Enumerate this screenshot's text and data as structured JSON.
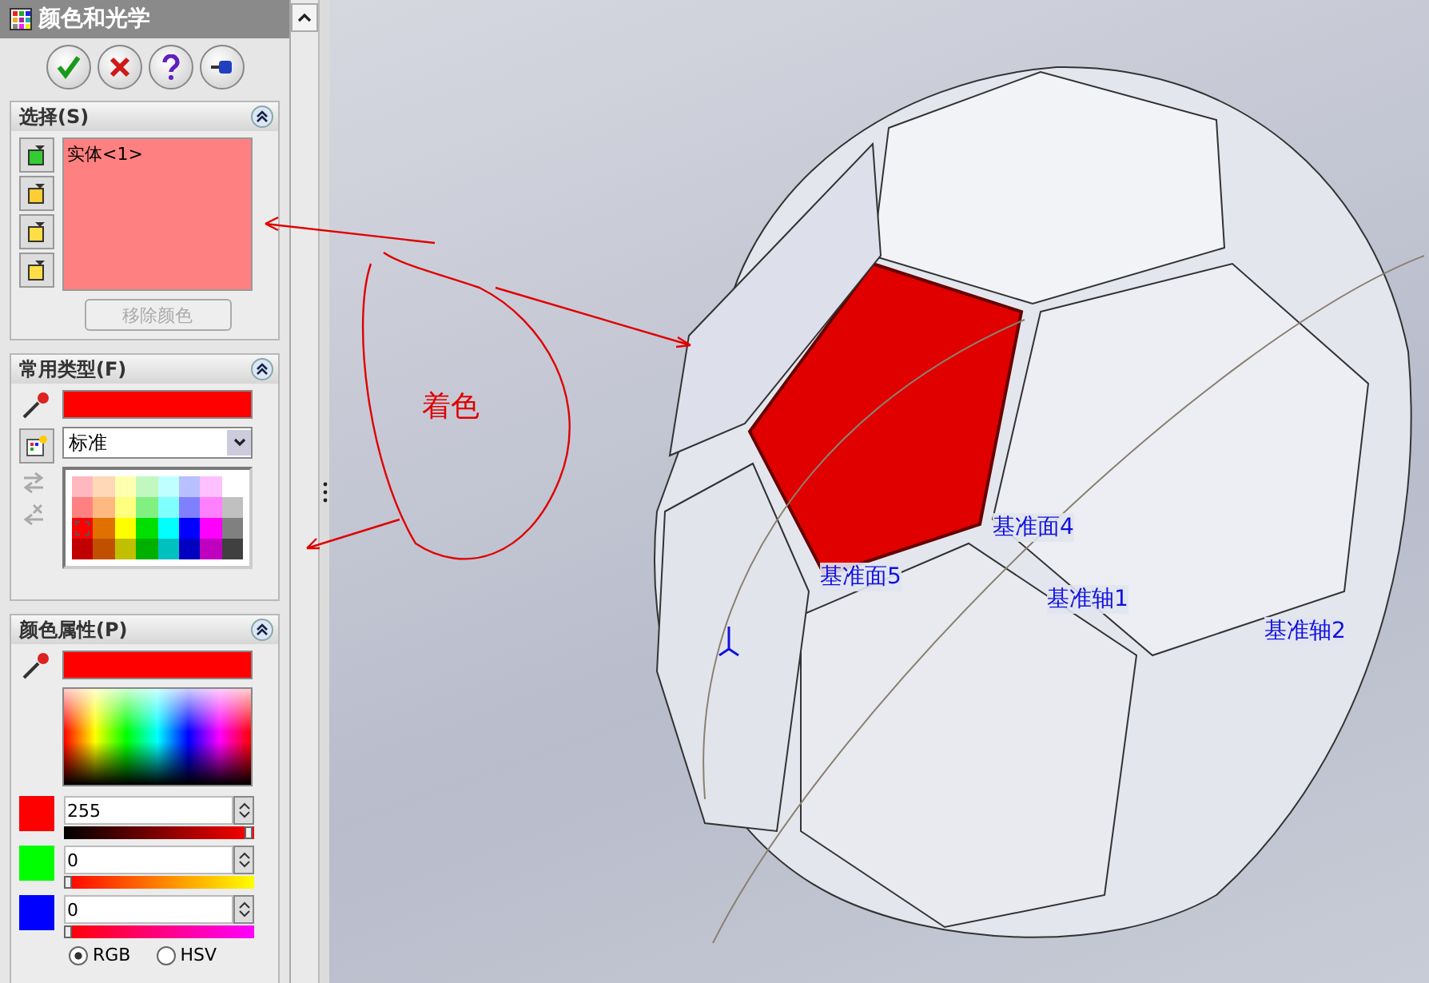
{
  "panel": {
    "title": "颜色和光学"
  },
  "selection": {
    "title": "选择(S)",
    "items": [
      "实体<1>"
    ],
    "remove_button": {
      "label": "移除颜色",
      "disabled": true
    }
  },
  "favorites": {
    "title": "常用类型(F)",
    "dropdown_value": "标准",
    "swatches": [
      {
        "color": "#ffb8c0",
        "selected": false
      },
      {
        "color": "#ffd8b8",
        "selected": false
      },
      {
        "color": "#ffffb0",
        "selected": false
      },
      {
        "color": "#c0f8c0",
        "selected": false
      },
      {
        "color": "#c0ffff",
        "selected": false
      },
      {
        "color": "#b8c0ff",
        "selected": false
      },
      {
        "color": "#ffc0ff",
        "selected": false
      },
      {
        "color": "#ffffff",
        "selected": false
      },
      {
        "color": "#ff8080",
        "selected": false
      },
      {
        "color": "#ffb880",
        "selected": false
      },
      {
        "color": "#ffff80",
        "selected": false
      },
      {
        "color": "#80f080",
        "selected": false
      },
      {
        "color": "#80ffff",
        "selected": false
      },
      {
        "color": "#8080ff",
        "selected": false
      },
      {
        "color": "#ff80ff",
        "selected": false
      },
      {
        "color": "#c0c0c0",
        "selected": false
      },
      {
        "color": "#ff0000",
        "selected": true
      },
      {
        "color": "#e07000",
        "selected": false
      },
      {
        "color": "#ffff00",
        "selected": false
      },
      {
        "color": "#00e000",
        "selected": false
      },
      {
        "color": "#00ffff",
        "selected": false
      },
      {
        "color": "#0000ff",
        "selected": false
      },
      {
        "color": "#ff00ff",
        "selected": false
      },
      {
        "color": "#808080",
        "selected": false
      },
      {
        "color": "#c00000",
        "selected": false
      },
      {
        "color": "#c05000",
        "selected": false
      },
      {
        "color": "#c0c000",
        "selected": false
      },
      {
        "color": "#00b000",
        "selected": false
      },
      {
        "color": "#00c0c0",
        "selected": false
      },
      {
        "color": "#0000c0",
        "selected": false
      },
      {
        "color": "#c000c0",
        "selected": false
      },
      {
        "color": "#404040",
        "selected": false
      }
    ]
  },
  "properties": {
    "title": "颜色属性(P)",
    "channels": [
      {
        "color": "#ff0000",
        "value": "255",
        "level": 1
      },
      {
        "color": "#00ff00",
        "value": "0",
        "level": 0
      },
      {
        "color": "#0000ff",
        "value": "0",
        "level": 0
      }
    ],
    "modes": [
      {
        "label": "RGB",
        "selected": true
      },
      {
        "label": "HSV",
        "selected": false
      }
    ]
  },
  "viewport": {
    "labels": [
      "基准面4",
      "基准面5",
      "基准轴1",
      "基准轴2"
    ],
    "annotation": "着色"
  }
}
